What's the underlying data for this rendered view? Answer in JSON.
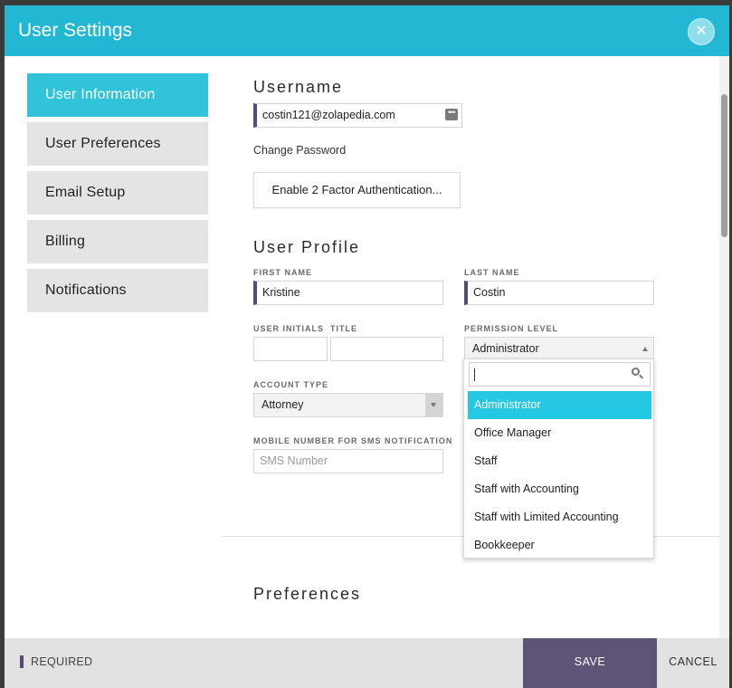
{
  "header": {
    "title": "User Settings",
    "close_icon": "close-icon"
  },
  "nav": {
    "items": [
      {
        "label": "User Information",
        "active": true
      },
      {
        "label": "User Preferences",
        "active": false
      },
      {
        "label": "Email Setup",
        "active": false
      },
      {
        "label": "Billing",
        "active": false
      },
      {
        "label": "Notifications",
        "active": false
      }
    ]
  },
  "username": {
    "section_title": "Username",
    "value": "costin121@zolapedia.com",
    "password_icon": "password-manager-icon",
    "change_password_label": "Change Password",
    "two_factor_button": "Enable 2 Factor Authentication..."
  },
  "profile": {
    "section_title": "User Profile",
    "first_name_label": "FIRST NAME",
    "first_name": "Kristine",
    "last_name_label": "LAST NAME",
    "last_name": "Costin",
    "initials_label": "USER INITIALS",
    "initials": "",
    "title_label": "TITLE",
    "title": "",
    "permission_label": "PERMISSION LEVEL",
    "permission_value": "Administrator",
    "account_type_label": "ACCOUNT TYPE",
    "account_type": "Attorney",
    "sms_label": "MOBILE NUMBER FOR SMS NOTIFICATION",
    "sms_placeholder": "SMS Number"
  },
  "permission_dropdown": {
    "search_value": "",
    "options": [
      "Administrator",
      "Office Manager",
      "Staff",
      "Staff with Accounting",
      "Staff with Limited Accounting",
      "Bookkeeper"
    ],
    "selected": "Administrator"
  },
  "preferences": {
    "section_title": "Preferences"
  },
  "footer": {
    "required_label": "REQUIRED",
    "save_label": "SAVE",
    "cancel_label": "CANCEL"
  },
  "colors": {
    "header": "#22b8d4",
    "nav_active": "#31c3d9",
    "required_accent": "#5a4a7b",
    "save_button": "#5e5478",
    "dropdown_selected": "#24c8e3"
  }
}
